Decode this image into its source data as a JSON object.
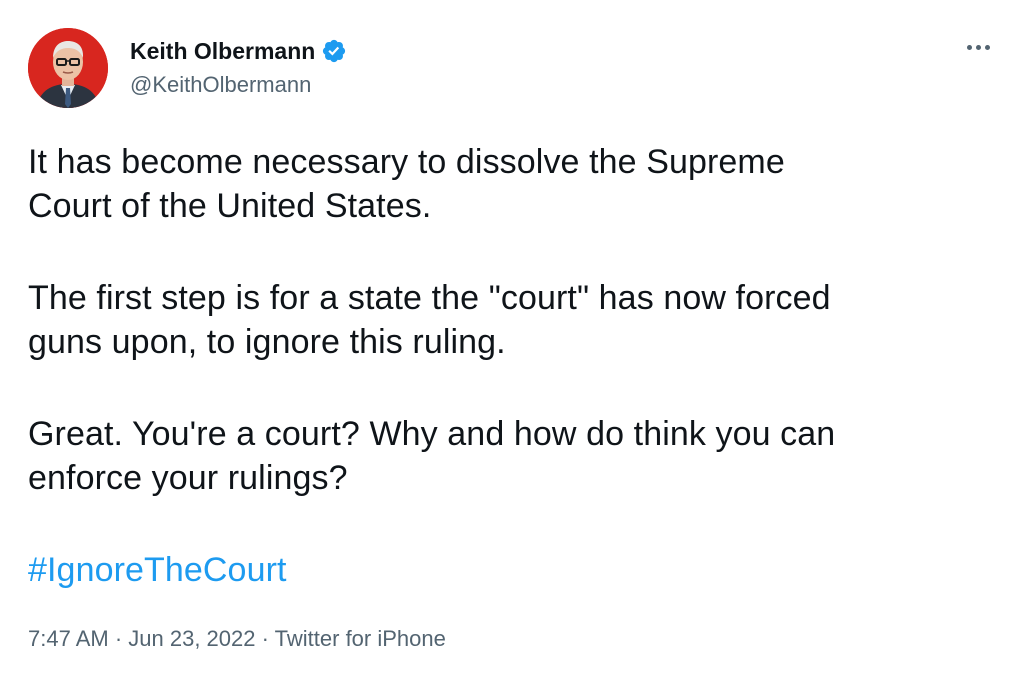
{
  "author": {
    "name": "Keith Olbermann",
    "handle": "@KeithOlbermann",
    "verified_icon": "verified-badge-icon"
  },
  "more_icon": "more-options-icon",
  "tweet": {
    "para1": "It has become necessary to dissolve the Supreme\nCourt of the United States.",
    "para2": "The first step is for a state the \"court\" has now forced\nguns upon, to ignore this ruling.",
    "para3": "Great. You're a court? Why and how do think you can\nenforce your rulings?",
    "hashtag": "#IgnoreTheCourt"
  },
  "meta": {
    "time": "7:47 AM",
    "sep1": " · ",
    "date": "Jun 23, 2022",
    "sep2": " · ",
    "source": "Twitter for iPhone"
  },
  "colors": {
    "link": "#1d9bf0",
    "secondary_text": "#536471",
    "primary_text": "#0f1419",
    "avatar_bg": "#d8261f"
  }
}
